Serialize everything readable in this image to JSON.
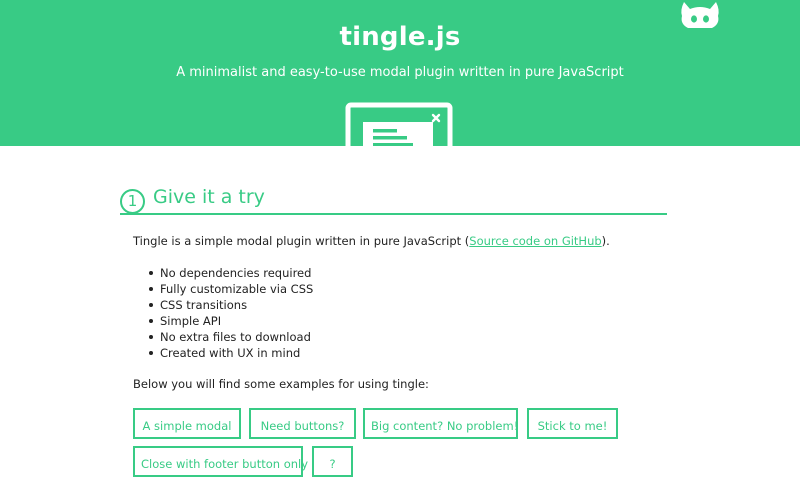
{
  "header": {
    "title": "tingle.js",
    "subtitle": "A minimalist and easy-to-use modal plugin written in pure JavaScript",
    "color": "#38cb85"
  },
  "section": {
    "number": "1",
    "title": "Give it a try"
  },
  "intro": {
    "text_before": "Tingle is a simple modal plugin written in pure JavaScript (",
    "link": "Source code on GitHub",
    "text_after": ")."
  },
  "features": [
    "No dependencies required",
    "Fully customizable via CSS",
    "CSS transitions",
    "Simple API",
    "No extra files to download",
    "Created with UX in mind"
  ],
  "examples_intro": "Below you will find some examples for using tingle:",
  "buttons": [
    "A simple modal",
    "Need buttons?",
    "Big content? No problem!",
    "Stick to me!",
    "Close with footer button only",
    "?"
  ],
  "icons": {
    "logo": "modal-window-icon",
    "github": "octocat-icon"
  }
}
